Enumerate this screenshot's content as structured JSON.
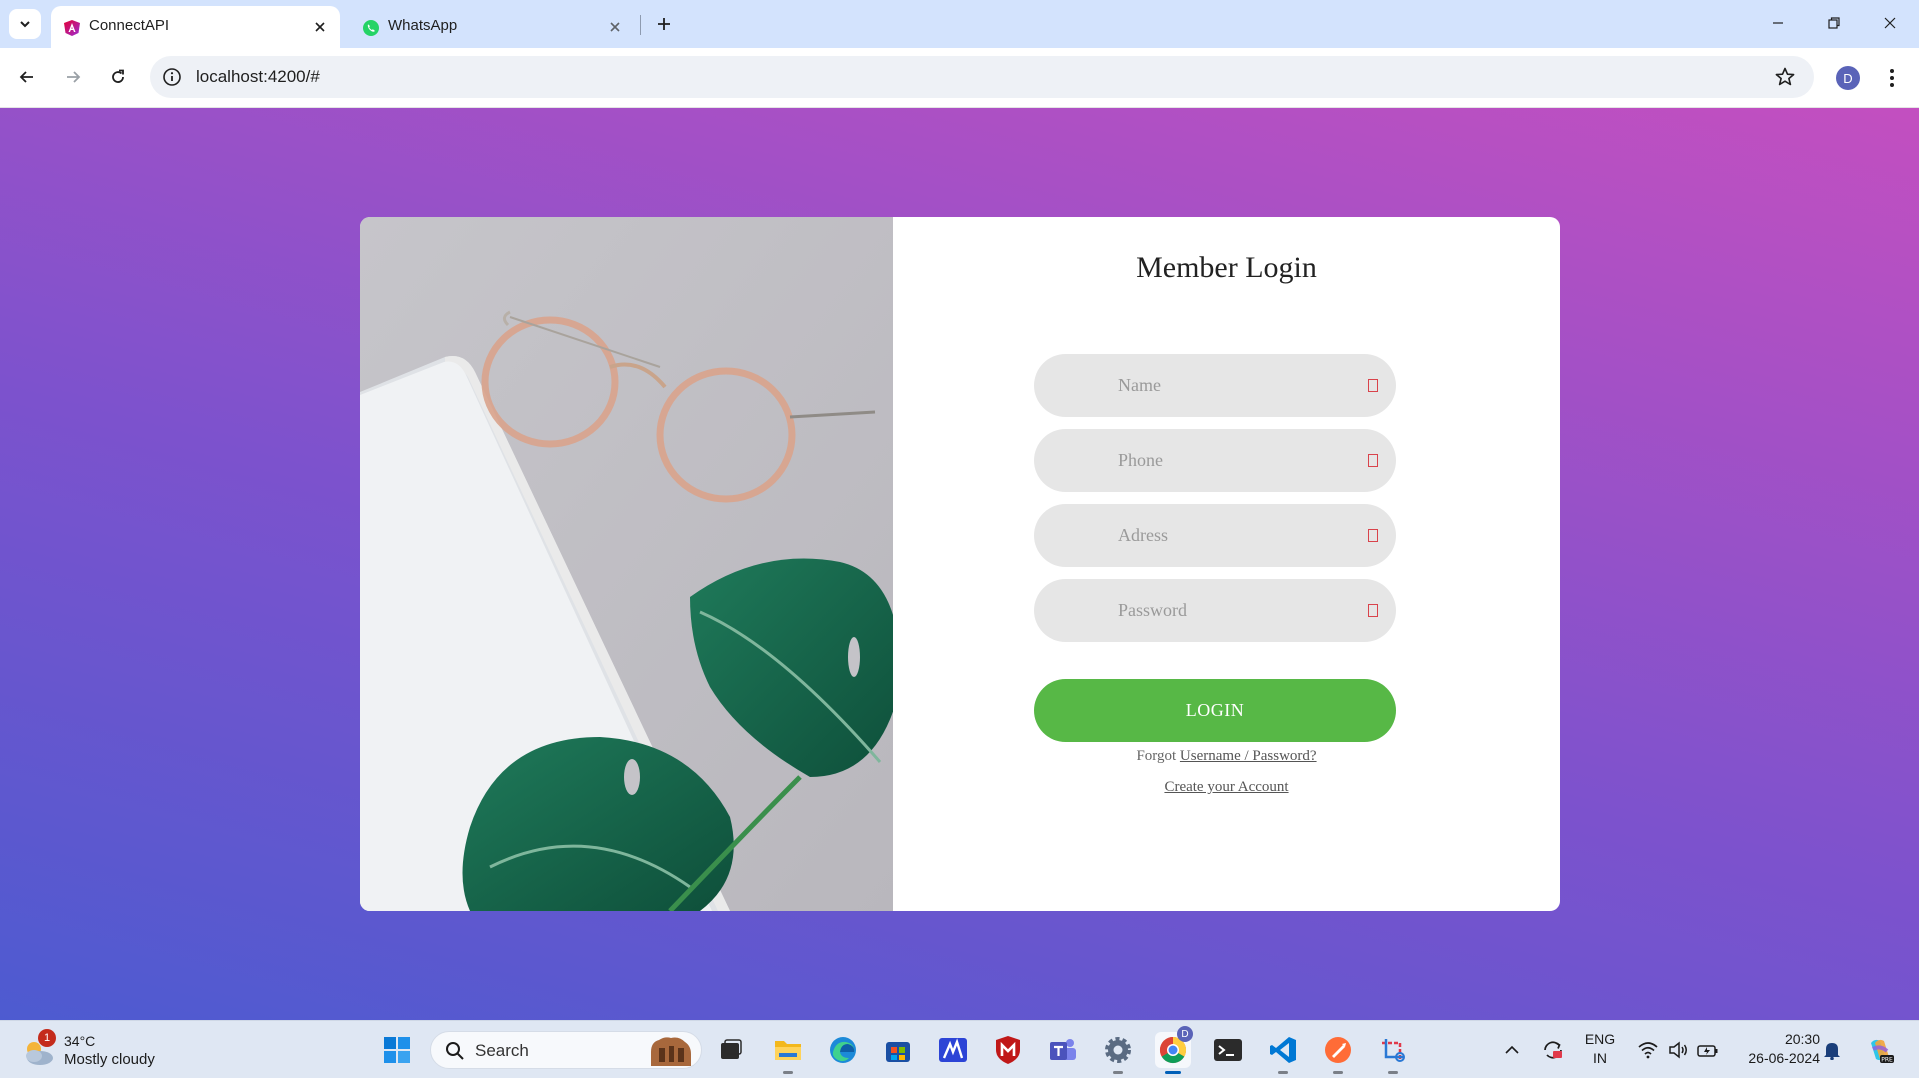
{
  "browser": {
    "tabs": [
      {
        "title": "ConnectAPI",
        "active": true,
        "icon": "angular-icon"
      },
      {
        "title": "WhatsApp",
        "active": false,
        "icon": "whatsapp-icon"
      }
    ],
    "url": "localhost:4200/#",
    "profile_initial": "D"
  },
  "login": {
    "title": "Member Login",
    "fields": [
      {
        "name": "name-field",
        "placeholder": "Name"
      },
      {
        "name": "phone-field",
        "placeholder": "Phone"
      },
      {
        "name": "address-field",
        "placeholder": "Adress"
      },
      {
        "name": "password-field",
        "placeholder": "Password"
      }
    ],
    "button": "LOGIN",
    "forgot_prefix": "Forgot",
    "forgot_link": "Username / Password?",
    "create_link": "Create your Account"
  },
  "colors": {
    "accent_green": "#57b846",
    "gradient_start": "#4d5bd0",
    "gradient_end": "#c34fc0"
  },
  "taskbar": {
    "weather_temp": "34°C",
    "weather_cond": "Mostly cloudy",
    "weather_badge": "1",
    "search_label": "Search",
    "lang_top": "ENG",
    "lang_bottom": "IN",
    "time": "20:30",
    "date": "26-06-2024",
    "chrome_badge": "D"
  }
}
